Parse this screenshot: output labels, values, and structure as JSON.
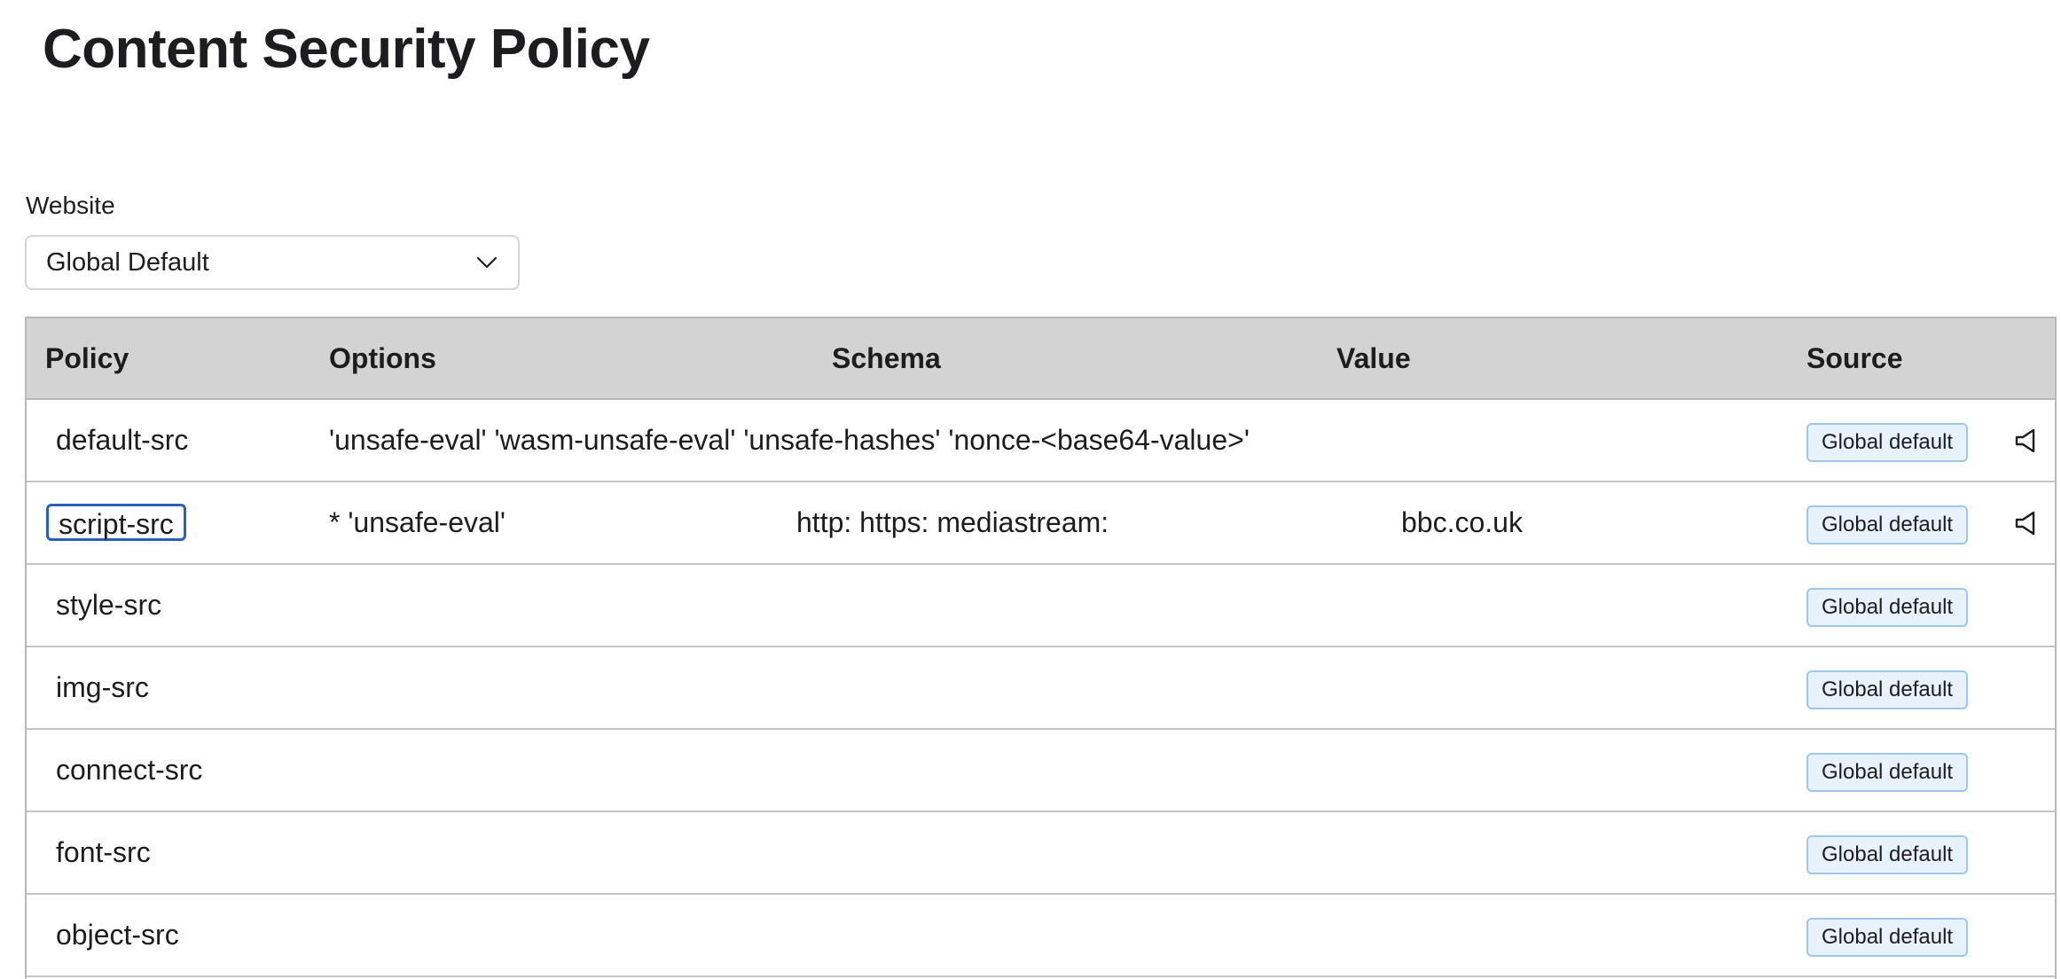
{
  "page": {
    "title": "Content Security Policy"
  },
  "website_selector": {
    "label": "Website",
    "selected_value": "Global Default",
    "icon": "chevron-down-icon"
  },
  "table": {
    "columns": {
      "policy": "Policy",
      "options": "Options",
      "schema": "Schema",
      "value": "Value",
      "source": "Source"
    },
    "rows": [
      {
        "policy": "default-src",
        "options": "'unsafe-eval' 'wasm-unsafe-eval' 'unsafe-hashes' 'nonce-<base64-value>'",
        "schema": "",
        "value": "",
        "source": "Global default",
        "action_icon": "speaker-icon"
      },
      {
        "policy": "script-src",
        "options": "* 'unsafe-eval'",
        "schema": "http: https: mediastream:",
        "value": "bbc.co.uk",
        "source": "Global default",
        "action_icon": "speaker-icon",
        "focused": true
      },
      {
        "policy": "style-src",
        "options": "",
        "schema": "",
        "value": "",
        "source": "Global default"
      },
      {
        "policy": "img-src",
        "options": "",
        "schema": "",
        "value": "",
        "source": "Global default"
      },
      {
        "policy": "connect-src",
        "options": "",
        "schema": "",
        "value": "",
        "source": "Global default"
      },
      {
        "policy": "font-src",
        "options": "",
        "schema": "",
        "value": "",
        "source": "Global default"
      },
      {
        "policy": "object-src",
        "options": "",
        "schema": "",
        "value": "",
        "source": "Global default"
      }
    ]
  },
  "colors": {
    "header_bg": "#d3d3d3",
    "badge_bg": "#e8f2fc",
    "badge_border": "#9fc7ee",
    "focus_ring": "#2b5fbf"
  }
}
